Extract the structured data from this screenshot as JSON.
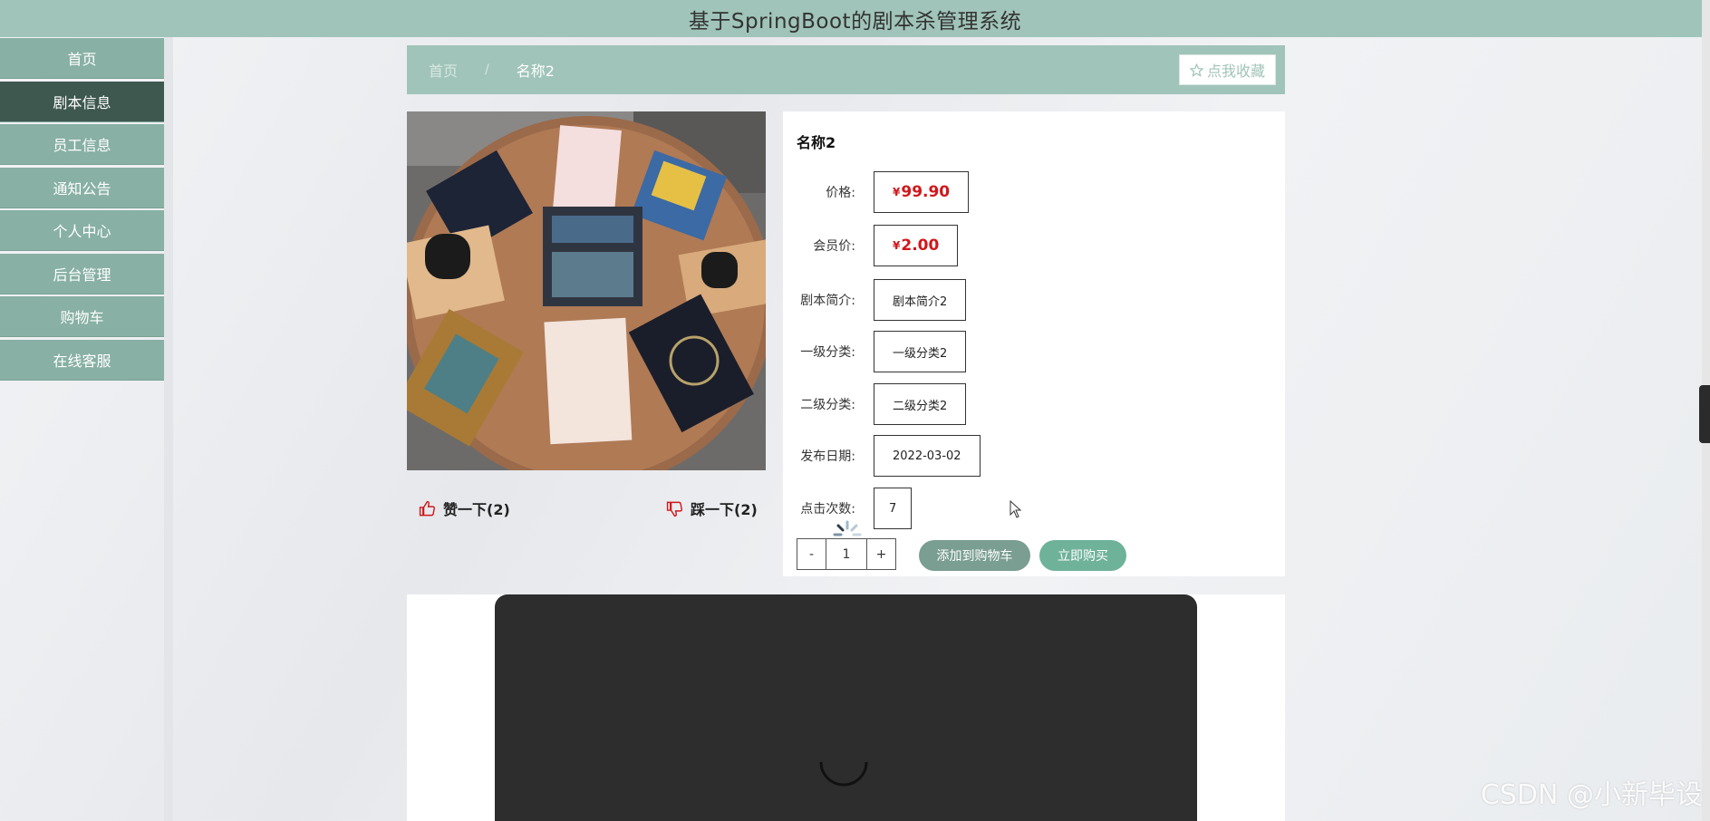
{
  "header": {
    "title": "基于SpringBoot的剧本杀管理系统"
  },
  "sidebar": {
    "items": [
      {
        "label": "首页"
      },
      {
        "label": "剧本信息"
      },
      {
        "label": "员工信息"
      },
      {
        "label": "通知公告"
      },
      {
        "label": "个人中心"
      },
      {
        "label": "后台管理"
      },
      {
        "label": "购物车"
      },
      {
        "label": "在线客服"
      }
    ],
    "active_index": 1
  },
  "breadcrumb": {
    "home": "首页",
    "separator": "/",
    "current": "名称2"
  },
  "favorite": {
    "icon": "star-outline-icon",
    "label": "点我收藏"
  },
  "product": {
    "name": "名称2",
    "currency": "¥",
    "fields": [
      {
        "label": "价格:",
        "value": "99.90"
      },
      {
        "label": "会员价:",
        "value": "2.00"
      },
      {
        "label": "剧本简介:",
        "value": "剧本简介2"
      },
      {
        "label": "一级分类:",
        "value": "一级分类2"
      },
      {
        "label": "二级分类:",
        "value": "二级分类2"
      },
      {
        "label": "发布日期:",
        "value": "2022-03-02"
      },
      {
        "label": "点击次数:",
        "value": "7"
      }
    ]
  },
  "votes": {
    "like": {
      "icon": "thumbs-up-icon",
      "label": "赞一下(2)"
    },
    "dislike": {
      "icon": "thumbs-down-icon",
      "label": "踩一下(2)"
    }
  },
  "quantity": {
    "minus": "-",
    "value": "1",
    "plus": "+"
  },
  "actions": {
    "add_to_cart": "添加到购物车",
    "buy_now": "立即购买"
  },
  "watermark": "CSDN @小新毕设",
  "colors": {
    "header": "#a0c4b9",
    "sidebar": "#88b0a4",
    "sidebar_active": "#3e5850",
    "price": "#d0171b",
    "buy": "#6fb29a",
    "cart": "#7a9e92"
  }
}
